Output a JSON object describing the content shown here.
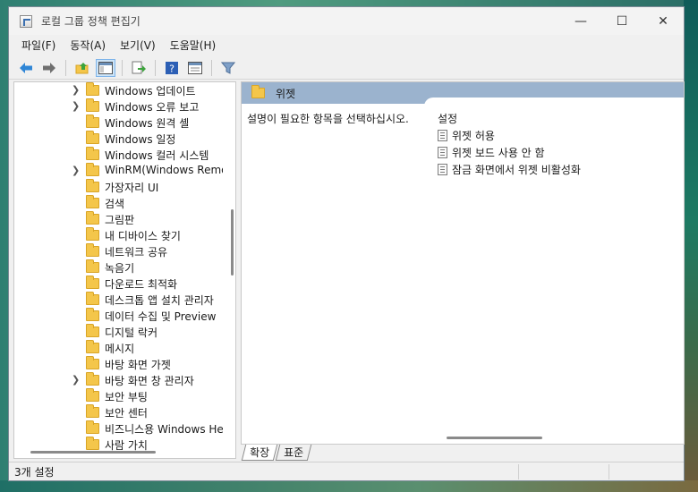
{
  "window": {
    "title": "로컬 그룹 정책 편집기",
    "controls": {
      "minimize": "—",
      "maximize": "☐",
      "close": "✕"
    }
  },
  "menu": [
    "파일(F)",
    "동작(A)",
    "보기(V)",
    "도움말(H)"
  ],
  "toolbar": {
    "icons": [
      "back-icon",
      "forward-icon",
      "up-folder-icon",
      "show-hide-tree-icon",
      "export-list-icon",
      "help-icon",
      "properties-icon",
      "filter-icon"
    ]
  },
  "tree": {
    "items": [
      {
        "label": "Windows 업데이트",
        "expandable": true
      },
      {
        "label": "Windows 오류 보고",
        "expandable": true
      },
      {
        "label": "Windows 원격 셸",
        "expandable": false
      },
      {
        "label": "Windows 일정",
        "expandable": false
      },
      {
        "label": "Windows 컬러 시스템",
        "expandable": false
      },
      {
        "label": "WinRM(Windows Remot",
        "expandable": true
      },
      {
        "label": "가장자리 UI",
        "expandable": false
      },
      {
        "label": "검색",
        "expandable": false
      },
      {
        "label": "그림판",
        "expandable": false
      },
      {
        "label": "내 디바이스 찾기",
        "expandable": false
      },
      {
        "label": "네트워크 공유",
        "expandable": false
      },
      {
        "label": "녹음기",
        "expandable": false
      },
      {
        "label": "다운로드 최적화",
        "expandable": false
      },
      {
        "label": "데스크톱 앱 설치 관리자",
        "expandable": false
      },
      {
        "label": "데이터 수집 및 Preview",
        "expandable": false
      },
      {
        "label": "디지털 락커",
        "expandable": false
      },
      {
        "label": "메시지",
        "expandable": false
      },
      {
        "label": "바탕 화면 가젯",
        "expandable": false
      },
      {
        "label": "바탕 화면 창 관리자",
        "expandable": true
      },
      {
        "label": "보안 부팅",
        "expandable": false
      },
      {
        "label": "보안 센터",
        "expandable": false
      },
      {
        "label": "비즈니스용 Windows He",
        "expandable": false
      },
      {
        "label": "사람 가치",
        "expandable": false
      }
    ]
  },
  "content": {
    "folder_title": "위젯",
    "description": "설명이 필요한 항목을 선택하십시오.",
    "settings_header": "설정",
    "settings": [
      "위젯 허용",
      "위젯 보드 사용 안 함",
      "잠금 화면에서 위젯 비활성화"
    ]
  },
  "tabs": [
    "확장",
    "표준"
  ],
  "status": {
    "text": "3개 설정"
  }
}
